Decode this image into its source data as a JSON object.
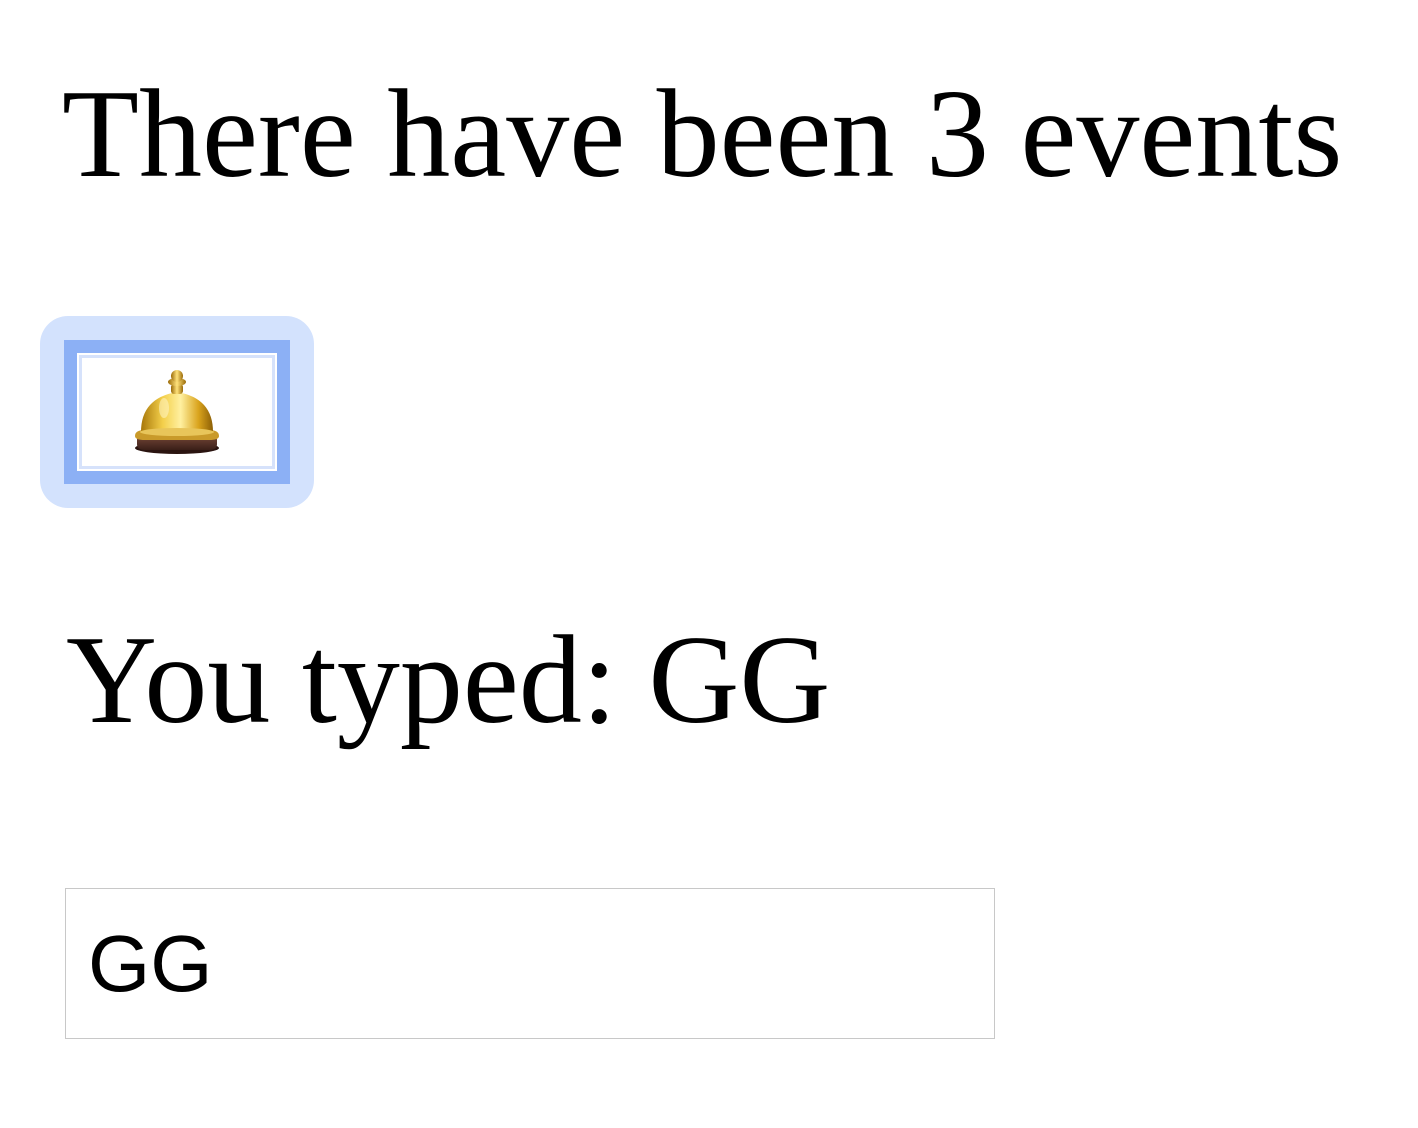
{
  "counter": {
    "prefix": "There have been",
    "count": "3",
    "suffix": "events"
  },
  "bell_button": {
    "icon": "bell-icon",
    "focused": true,
    "colors": {
      "focus_ring_outer": "#d3e2fd",
      "border": "#8cb0f5"
    }
  },
  "typed": {
    "label": "You typed:",
    "value": "GG"
  },
  "input": {
    "value": "GG"
  }
}
